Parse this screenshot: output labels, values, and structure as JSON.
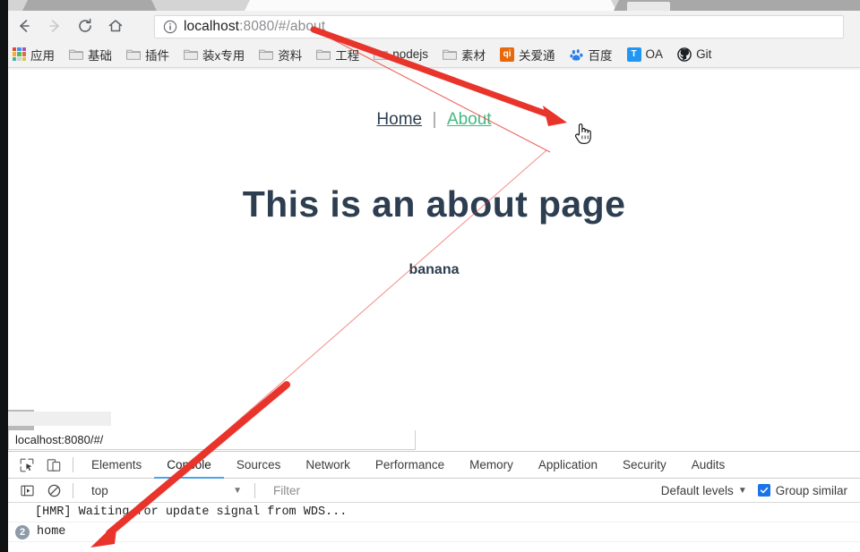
{
  "browser": {
    "nav": {
      "back_label": "Back",
      "forward_label": "Forward",
      "reload_label": "Reload",
      "home_label": "Home"
    },
    "omnibox": {
      "url_full": "localhost:8080/#/about",
      "url_host": "localhost",
      "url_rest": ":8080/#/about",
      "info_icon": "info-circle-icon"
    },
    "bookmarks": [
      {
        "label": "应用",
        "icon": "apps-grid-icon"
      },
      {
        "label": "基础",
        "icon": "folder-icon"
      },
      {
        "label": "插件",
        "icon": "folder-icon"
      },
      {
        "label": "装x专用",
        "icon": "folder-icon"
      },
      {
        "label": "资料",
        "icon": "folder-icon"
      },
      {
        "label": "工程",
        "icon": "folder-icon"
      },
      {
        "label": "nodejs",
        "icon": "folder-icon"
      },
      {
        "label": "素材",
        "icon": "folder-icon"
      },
      {
        "label": "关爱通",
        "icon": "qi-favicon",
        "icon_text": "qi",
        "icon_color": "#e8690b"
      },
      {
        "label": "百度",
        "icon": "baidu-paw-icon",
        "icon_color": "#2b7fe8"
      },
      {
        "label": "OA",
        "icon": "oa-favicon",
        "icon_text": "T",
        "icon_color": "#2196f3"
      },
      {
        "label": "Git",
        "icon": "github-icon",
        "icon_color": "#1b1f23"
      }
    ]
  },
  "page": {
    "nav": {
      "home_label": "Home",
      "separator": "|",
      "about_label": "About"
    },
    "heading": "This is an about page",
    "subtitle": "banana",
    "colors": {
      "heading": "#2c3e50",
      "link_active": "#42b983",
      "link_visited": "#2c3e50"
    }
  },
  "status_bar": {
    "link_preview": "localhost:8080/#/"
  },
  "devtools": {
    "toolbar_icons": [
      {
        "name": "inspect-element-icon"
      },
      {
        "name": "toggle-device-toolbar-icon"
      }
    ],
    "tabs": [
      {
        "label": "Elements",
        "active": false
      },
      {
        "label": "Console",
        "active": true
      },
      {
        "label": "Sources",
        "active": false
      },
      {
        "label": "Network",
        "active": false
      },
      {
        "label": "Performance",
        "active": false
      },
      {
        "label": "Memory",
        "active": false
      },
      {
        "label": "Application",
        "active": false
      },
      {
        "label": "Security",
        "active": false
      },
      {
        "label": "Audits",
        "active": false
      }
    ],
    "console_toolbar": {
      "sidebar_toggle_icon": "console-sidebar-icon",
      "clear_icon": "clear-console-icon",
      "context_value": "top",
      "context_caret": "▼",
      "filter_placeholder": "Filter",
      "levels_label": "Default levels",
      "levels_caret": "▼",
      "group_similar_label": "Group similar",
      "group_similar_checked": true,
      "checkbox_color": "#1a73e8"
    },
    "messages": [
      {
        "text": "[HMR] Waiting for update signal from WDS...",
        "count": null
      },
      {
        "text": "home",
        "count": "2"
      }
    ]
  },
  "annotations": {
    "arrow_color": "#e8342a",
    "arrows": [
      {
        "name": "arrow-url-to-home-link",
        "from": "omnibox",
        "to": "page-home-link"
      },
      {
        "name": "arrow-home-link-to-console-home",
        "from": "page-home-link",
        "to": "console-home-message"
      }
    ]
  }
}
